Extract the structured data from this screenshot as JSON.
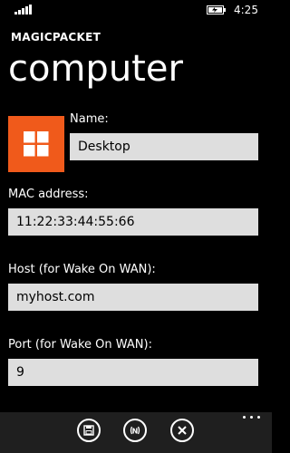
{
  "status_bar": {
    "time": "4:25",
    "signal_icon": "signal-strength-icon",
    "battery_icon": "battery-icon"
  },
  "header": {
    "app_name": "MAGICPACKET",
    "page_title": "computer"
  },
  "tile": {
    "icon": "windows-logo-icon",
    "color": "#f05a1b"
  },
  "form": {
    "name_label": "Name:",
    "name_value": "Desktop",
    "mac_label": "MAC address:",
    "mac_value": "11:22:33:44:55:66",
    "host_label": "Host (for Wake On WAN):",
    "host_value": "myhost.com",
    "port_label": "Port (for Wake On WAN):",
    "port_value": "9"
  },
  "app_bar": {
    "buttons": [
      {
        "icon": "save-icon"
      },
      {
        "icon": "wake-signal-icon"
      },
      {
        "icon": "close-icon"
      }
    ],
    "more_icon": "ellipsis-icon",
    "background": "#1f1f1f"
  }
}
